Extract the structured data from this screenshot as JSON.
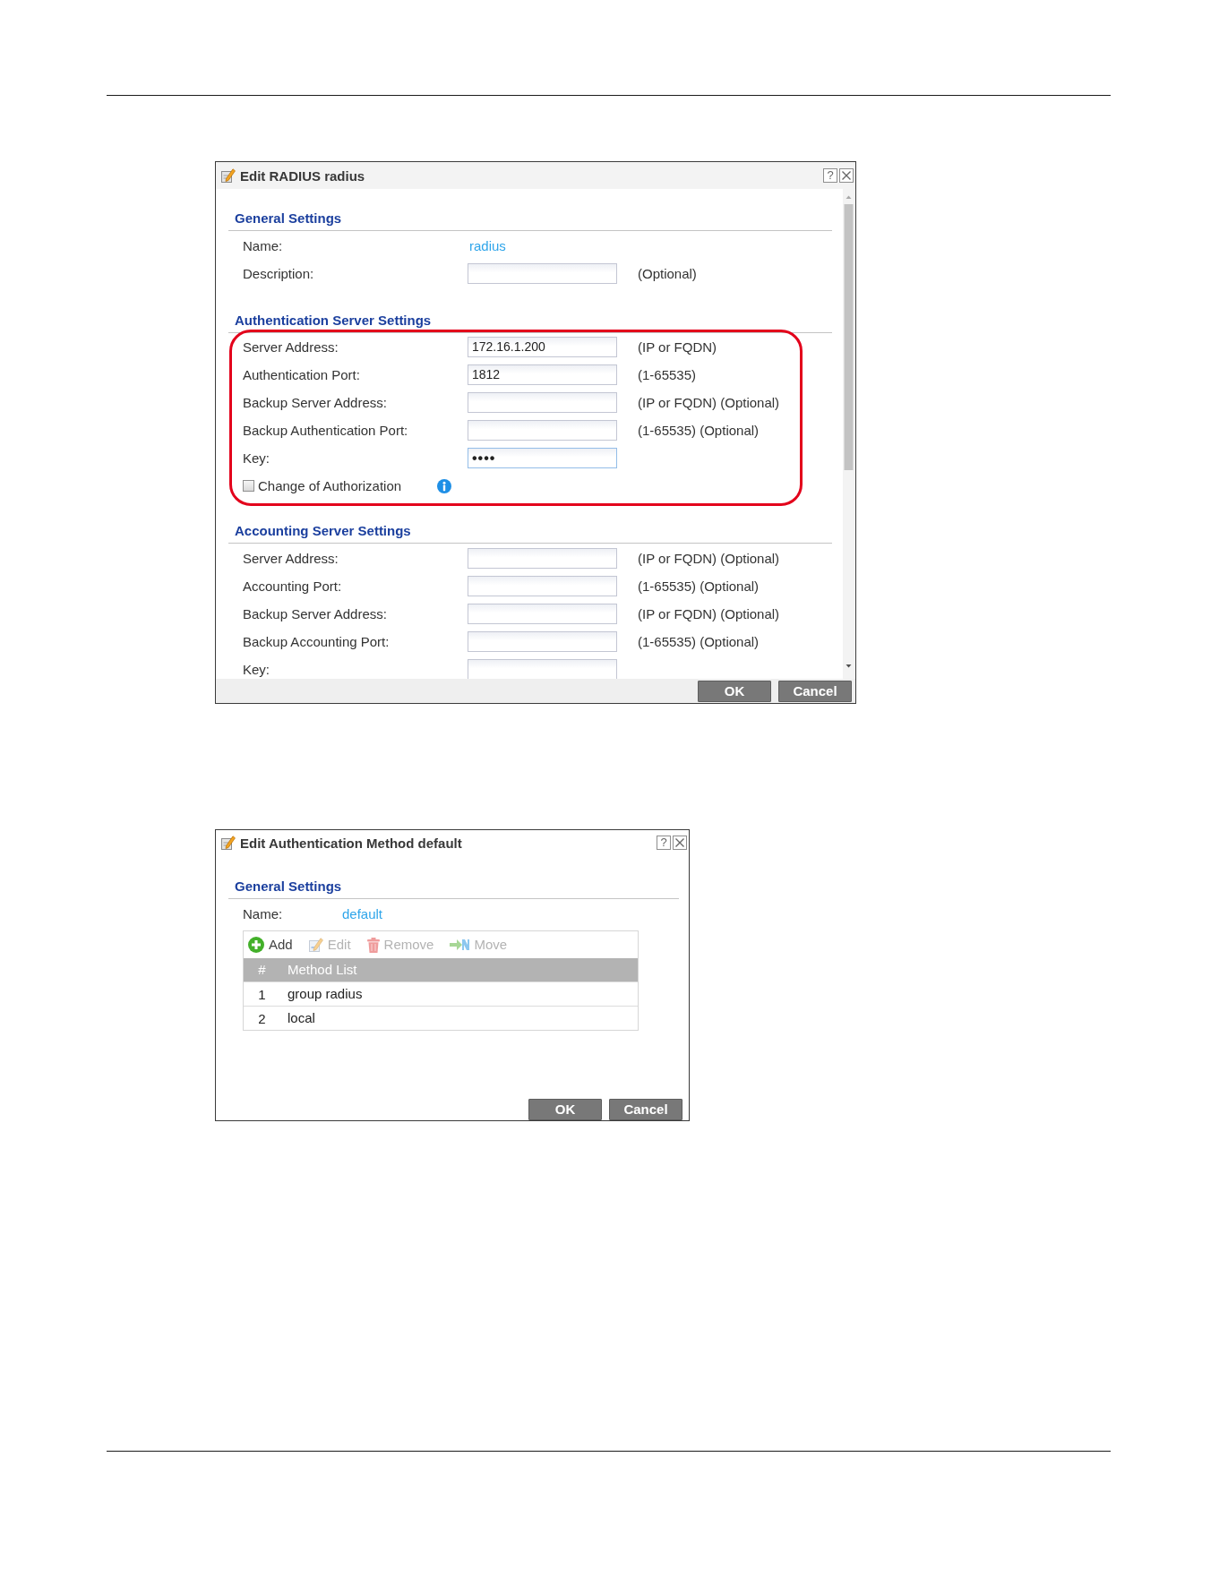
{
  "radius_dialog": {
    "title": "Edit RADIUS radius",
    "help_button": "?",
    "sections": [
      {
        "heading": "General Settings",
        "highlighted": false,
        "rows": [
          {
            "kind": "text",
            "label": "Name:",
            "value": "radius"
          },
          {
            "kind": "input",
            "label": "Description:",
            "focused": false,
            "note": "(Optional)"
          }
        ]
      },
      {
        "heading": "Authentication Server Settings",
        "highlighted": true,
        "rows": [
          {
            "kind": "input",
            "label": "Server Address:",
            "value": "172.16.1.200",
            "focused": false,
            "note": "(IP or FQDN)"
          },
          {
            "kind": "input",
            "label": "Authentication Port:",
            "value": "1812",
            "focused": false,
            "note": "(1-65535)"
          },
          {
            "kind": "input",
            "label": "Backup Server Address:",
            "focused": false,
            "note": "(IP or FQDN) (Optional)"
          },
          {
            "kind": "input",
            "label": "Backup Authentication Port:",
            "focused": false,
            "note": "(1-65535) (Optional)"
          },
          {
            "kind": "password",
            "label": "Key:",
            "value": "••••",
            "focused": true
          },
          {
            "kind": "checkbox",
            "label": "Change of Authorization",
            "checked": false,
            "info": true
          }
        ]
      },
      {
        "heading": "Accounting Server Settings",
        "highlighted": false,
        "rows": [
          {
            "kind": "input",
            "label": "Server Address:",
            "focused": false,
            "note": "(IP or FQDN) (Optional)"
          },
          {
            "kind": "input",
            "label": "Accounting Port:",
            "focused": false,
            "note": "(1-65535) (Optional)"
          },
          {
            "kind": "input",
            "label": "Backup Server Address:",
            "focused": false,
            "note": "(IP or FQDN) (Optional)"
          },
          {
            "kind": "input",
            "label": "Backup Accounting Port:",
            "focused": false,
            "note": "(1-65535) (Optional)"
          },
          {
            "kind": "password",
            "label": "Key:",
            "focused": false
          }
        ]
      }
    ],
    "buttons": [
      "OK",
      "Cancel"
    ]
  },
  "method_dialog": {
    "title": "Edit Authentication Method default",
    "help_button": "?",
    "heading": "General Settings",
    "name_label": "Name:",
    "name_value": "default",
    "toolbar": [
      {
        "kind": "add",
        "label": "Add",
        "disabled": false
      },
      {
        "kind": "edit",
        "label": "Edit",
        "disabled": true
      },
      {
        "kind": "remove",
        "label": "Remove",
        "disabled": true
      },
      {
        "kind": "move",
        "label": "Move",
        "disabled": true
      }
    ],
    "table": {
      "columns": [
        "#",
        "Method List"
      ],
      "rows": [
        {
          "index": "1",
          "method": "group radius",
          "selected": false
        },
        {
          "index": "2",
          "method": "local",
          "selected": false
        }
      ]
    },
    "buttons": [
      "OK",
      "Cancel"
    ]
  }
}
